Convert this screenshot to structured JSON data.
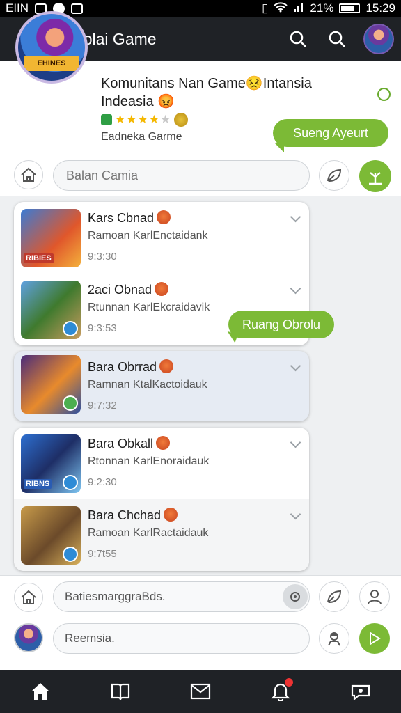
{
  "status_bar": {
    "carrier": "EIIN",
    "battery": "21%",
    "time": "15:29"
  },
  "app_bar": {
    "title": "Manolai Game",
    "icons": [
      "menu-icon",
      "search-icon",
      "search-icon",
      "profile-avatar"
    ]
  },
  "community": {
    "title": "Komunitans Nan Game😣Intansia Indeasia",
    "title_emoji_end": "😡",
    "badge_text": "EHINES",
    "subtitle": "Eadneka Garme",
    "rating": 4,
    "rating_max": 5,
    "join_label": "Sueng Ayeurt"
  },
  "search": {
    "placeholder": "Balan Camia"
  },
  "chats": [
    {
      "name": "Kars Cbnad",
      "message": "Ramoan KarlEnctaidank",
      "time": "9:3:30",
      "thumb_label": "RIBIES"
    },
    {
      "name": "2aci Obnad",
      "message": "Rtunnan KarlEkcraidavik",
      "time": "9:3:53",
      "thumb_label": ""
    },
    {
      "name": "Bara Obrrad",
      "message": "Ramnan KtalKactoidauk",
      "time": "9:7:32",
      "thumb_label": ""
    },
    {
      "name": "Bara Obkall",
      "message": "Rtonnan KarlEnoraidauk",
      "time": "9:2:30",
      "thumb_label": "RIBNS"
    },
    {
      "name": "Bara Chchad",
      "message": "Ramoan KarlRactaidauk",
      "time": "9:7t55",
      "thumb_label": ""
    }
  ],
  "room_bubble": "Ruang Obrolu",
  "composer": {
    "field1_value": "BatiesmarggraBds.",
    "field2_value": "Reemsia."
  },
  "tab_bar": {
    "tabs": [
      "home-icon",
      "book-icon",
      "mail-icon",
      "bell-icon",
      "chat-icon"
    ],
    "active": "home-icon"
  },
  "colors": {
    "accent": "#7cba36",
    "bar": "#1f2226"
  }
}
